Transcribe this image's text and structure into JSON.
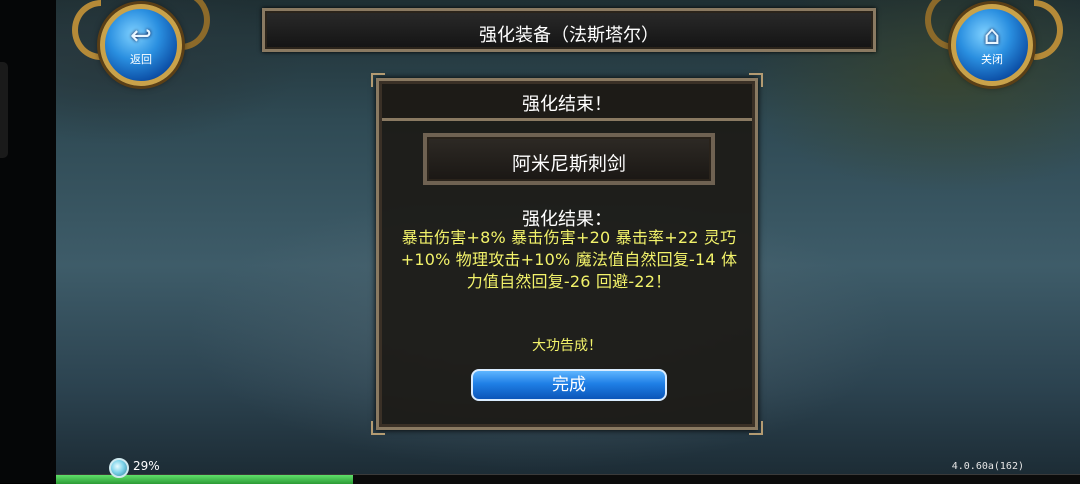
{
  "header": {
    "title": "强化装备（法斯塔尔）",
    "back_button": {
      "label": "返回",
      "icon": "back-arrow-icon"
    },
    "close_button": {
      "label": "关闭",
      "icon": "home-icon"
    }
  },
  "dialog": {
    "title": "强化结束！",
    "item_name": "阿米尼斯刺剑",
    "result_heading": "强化结果：",
    "result_text": "暴击伤害+8% 暴击伤害+20 暴击率+22 灵巧+10% 物理攻击+10% 魔法值自然回复-14 体力值自然回复-26 回避-22！",
    "success_text": "大功告成！",
    "done_button": "完成"
  },
  "footer": {
    "progress_percent_label": "29%",
    "progress": 0.29,
    "version": "4.0.60a(162)"
  },
  "colors": {
    "accent_blue": "#1f7fe6",
    "result_yellow": "#f2f26a",
    "frame_gold": "#8a7a62"
  }
}
